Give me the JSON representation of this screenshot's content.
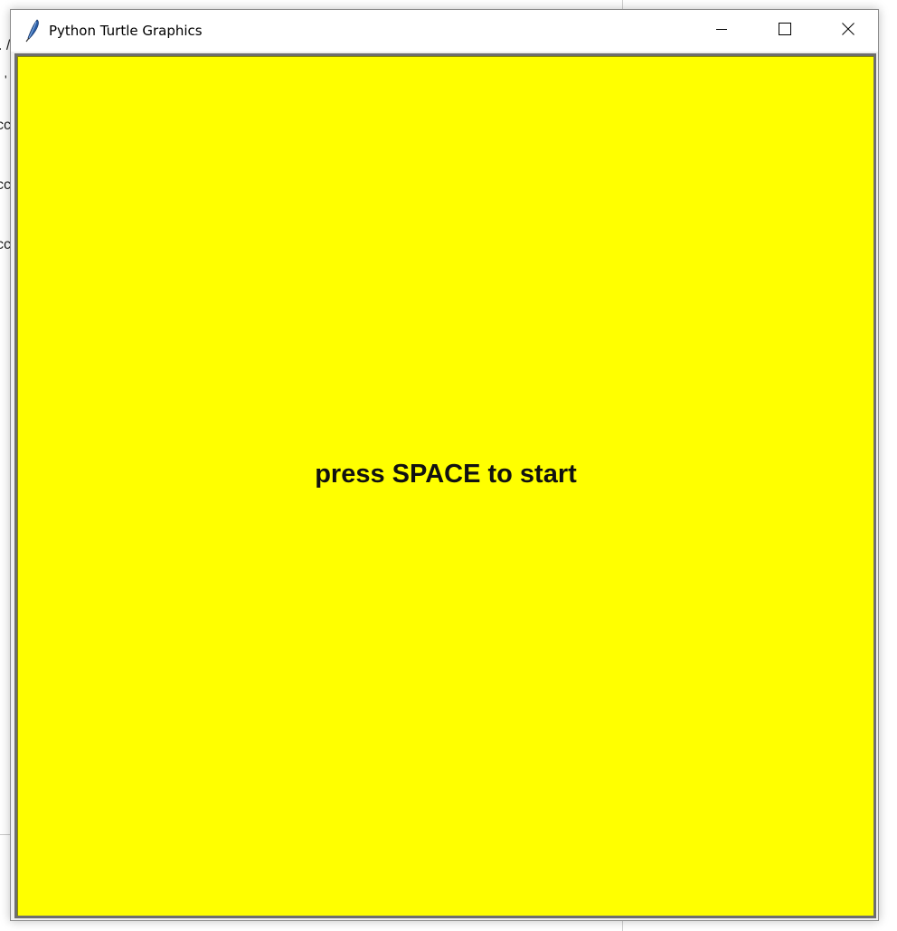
{
  "background_window": {
    "fragments": [
      ". /",
      "'",
      "cc",
      "cc",
      "cc"
    ]
  },
  "window": {
    "title": "Python Turtle Graphics",
    "icon": "feather-icon",
    "controls": {
      "minimize_icon": "minimize-icon",
      "maximize_icon": "maximize-icon",
      "close_icon": "close-icon"
    }
  },
  "canvas": {
    "background_color": "#ffff00",
    "message": "press SPACE to start"
  }
}
